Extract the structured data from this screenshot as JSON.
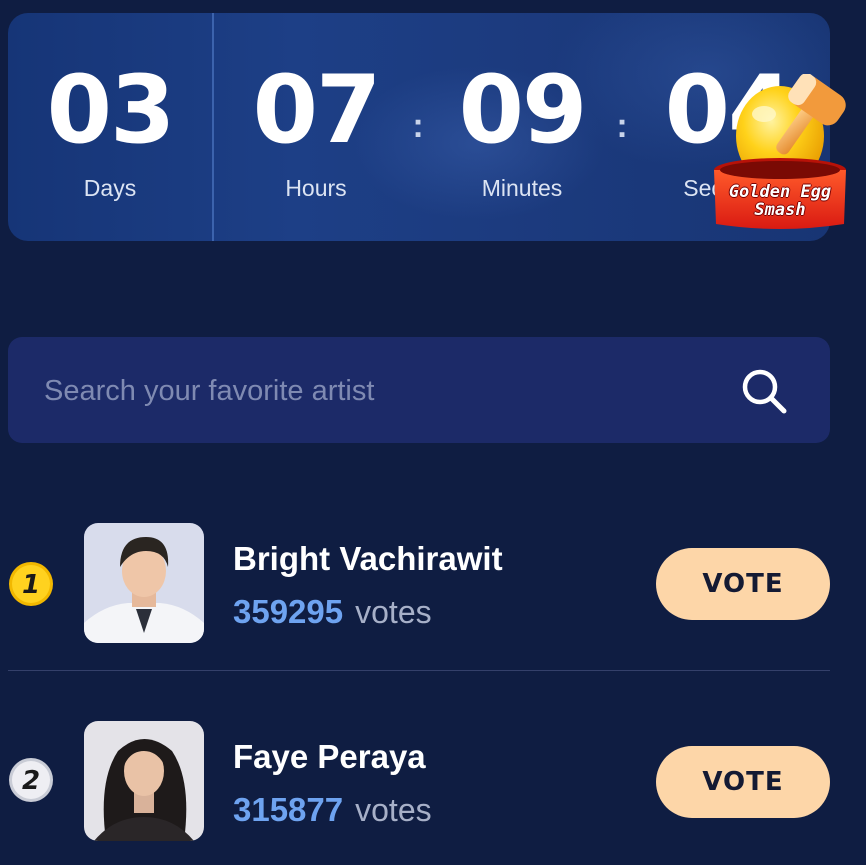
{
  "countdown": {
    "units": [
      {
        "value": "03",
        "label": "Days"
      },
      {
        "value": "07",
        "label": "Hours"
      },
      {
        "value": "09",
        "label": "Minutes"
      },
      {
        "value": "04",
        "label": "Seconds"
      }
    ],
    "separator": ":"
  },
  "promo_badge": {
    "text_line1": "Golden Egg",
    "text_line2": "Smash",
    "icon": "golden-egg-hammer-icon"
  },
  "search": {
    "placeholder": "Search your favorite artist",
    "value": "",
    "icon": "search-icon"
  },
  "artists": [
    {
      "rank": "1",
      "name": "Bright Vachirawit",
      "votes": "359295",
      "votes_label": "votes",
      "button_label": "VOTE",
      "badge_color": "#ffd21f"
    },
    {
      "rank": "2",
      "name": "Faye Peraya",
      "votes": "315877",
      "votes_label": "votes",
      "button_label": "VOTE",
      "badge_color": "#e9e9ee"
    }
  ],
  "colors": {
    "background": "#0f1d42",
    "accent_votes": "#6ea3f0",
    "vote_button": "#fdd6a8"
  }
}
